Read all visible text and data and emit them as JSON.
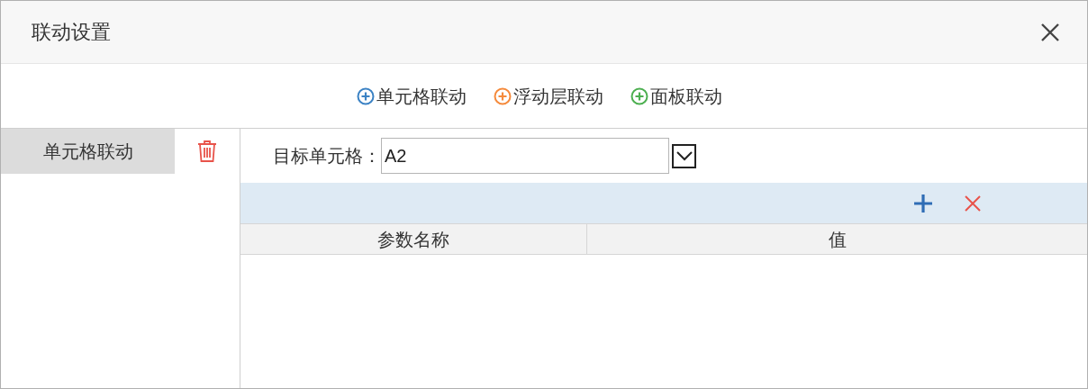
{
  "window": {
    "title": "联动设置"
  },
  "add_buttons": [
    {
      "label": "单元格联动",
      "color": "#3b82c4"
    },
    {
      "label": "浮动层联动",
      "color": "#f58a3c"
    },
    {
      "label": "面板联动",
      "color": "#4caf50"
    }
  ],
  "links": [
    {
      "label": "单元格联动",
      "selected": true
    }
  ],
  "target": {
    "label": "目标单元格：",
    "value": "A2"
  },
  "table": {
    "columns": [
      "参数名称",
      "值"
    ]
  }
}
